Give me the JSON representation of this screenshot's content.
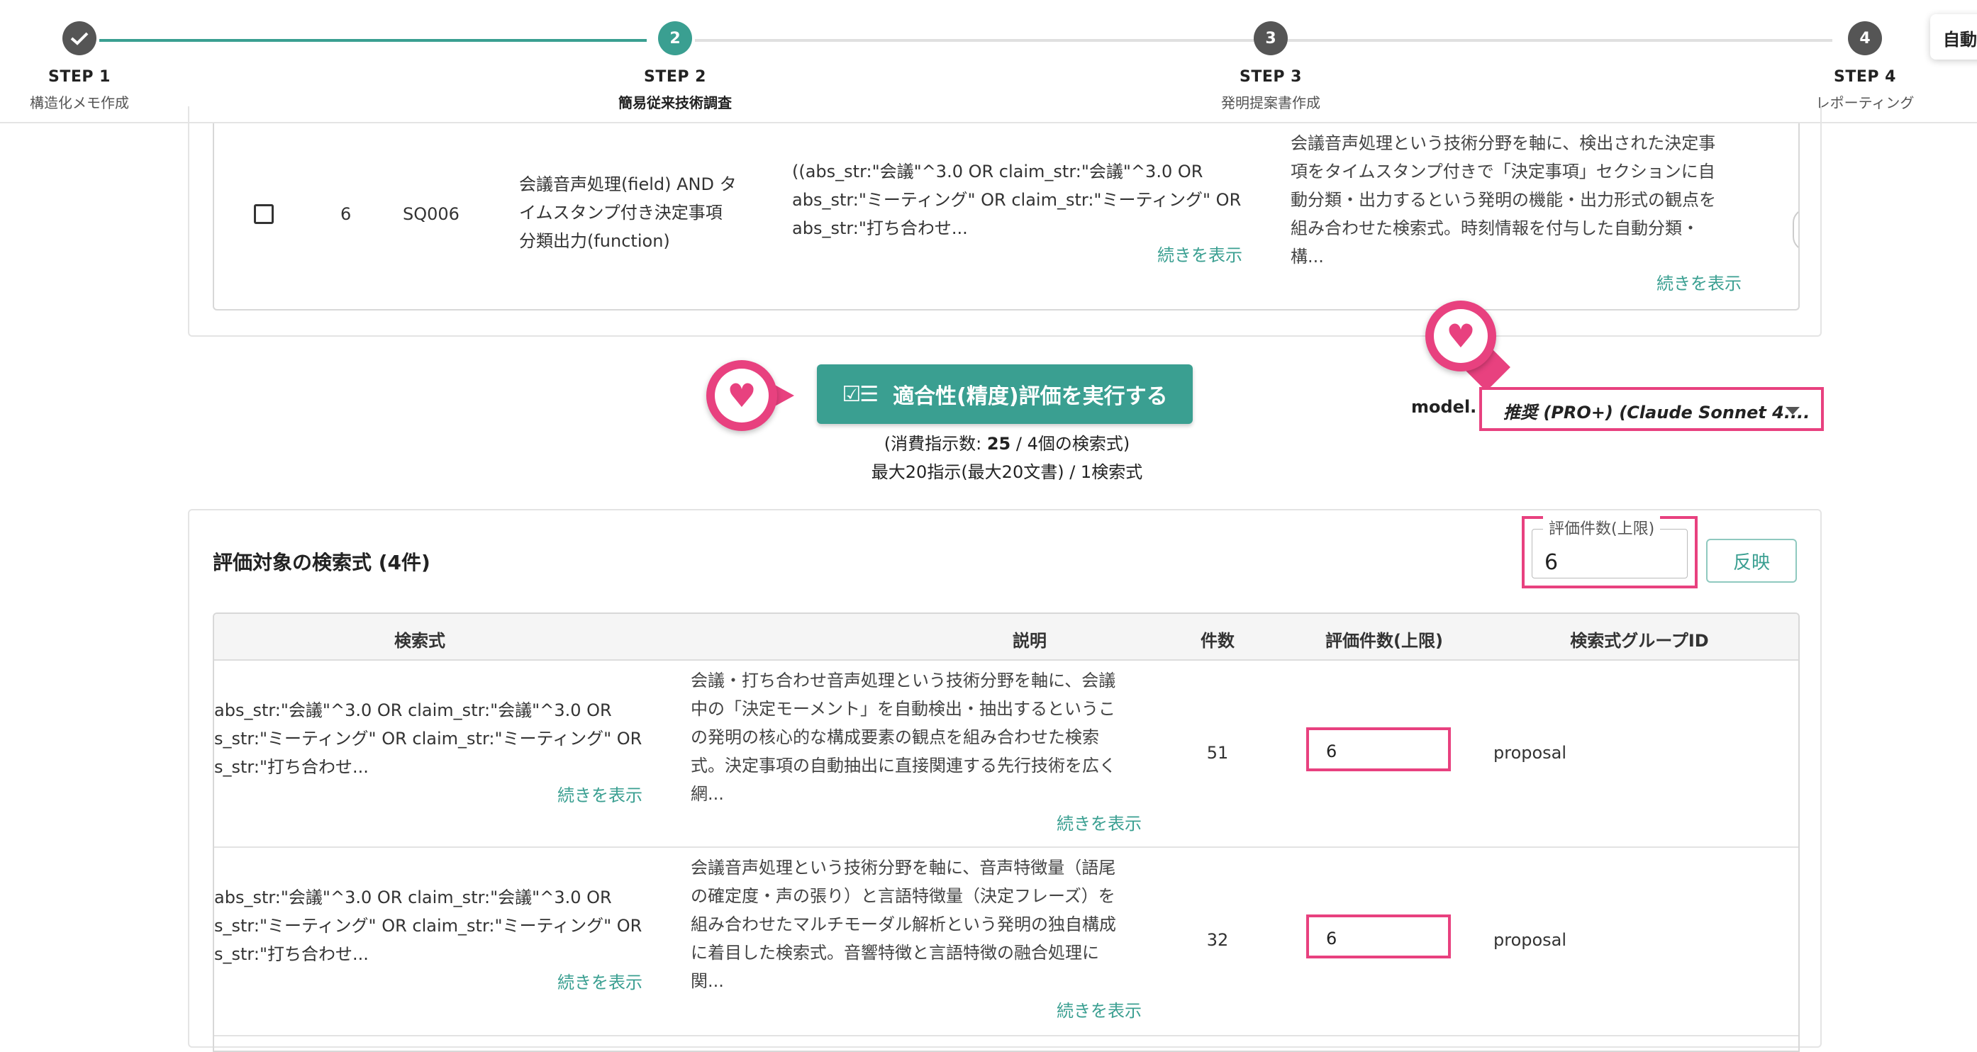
{
  "stepper": {
    "steps": [
      {
        "name": "STEP 1",
        "sub": "構造化メモ作成",
        "marker": "check-icon"
      },
      {
        "name": "STEP 2",
        "sub": "簡易従来技術調査",
        "marker": "2"
      },
      {
        "name": "STEP 3",
        "sub": "発明提案書作成",
        "marker": "3"
      },
      {
        "name": "STEP 4",
        "sub": "レポーティング",
        "marker": "4"
      }
    ],
    "auto_button": "自動"
  },
  "upper_row": {
    "no": "6",
    "id": "SQ006",
    "name": [
      "会議音声処理(field) AND タ",
      "イムスタンプ付き決定事項",
      "分類出力(function)"
    ],
    "query": [
      "((abs_str:\"会議\"^3.0 OR claim_str:\"会議\"^3.0 OR",
      "abs_str:\"ミーティング\" OR claim_str:\"ミーティング\" OR",
      "abs_str:\"打ち合わせ..."
    ],
    "query_more": "続きを表示",
    "desc": [
      "会議音声処理という技術分野を軸に、検出された決定事",
      "項をタイムスタンプ付きで「決定事項」セクションに自",
      "動分類・出力するという発明の機能・出力形式の観点を",
      "組み合わせた検索式。時刻情報を付与した自動分類・",
      "構..."
    ],
    "desc_more": "続きを表示"
  },
  "actions": {
    "run_button": "適合性(精度)評価を実行する",
    "consume_prefix": "(消費指示数: ",
    "consume_count": "25",
    "consume_suffix": " / 4個の検索式)",
    "max_note": "最大20指示(最大20文書) / 1検索式",
    "model_label": "model.",
    "model_value": "推奨 (PRO+) (Claude Sonnet 4...."
  },
  "eval_section": {
    "title": "評価対象の検索式 (4件)",
    "limit_legend": "評価件数(上限)",
    "limit_value": "6",
    "apply_button": "反映",
    "columns": [
      "検索式",
      "説明",
      "件数",
      "評価件数(上限)",
      "検索式グループID"
    ],
    "rows": [
      {
        "query": [
          "abs_str:\"会議\"^3.0 OR claim_str:\"会議\"^3.0 OR",
          "s_str:\"ミーティング\" OR claim_str:\"ミーティング\" OR",
          "s_str:\"打ち合わせ..."
        ],
        "query_more": "続きを表示",
        "desc": [
          "会議・打ち合わせ音声処理という技術分野を軸に、会議",
          "中の「決定モーメント」を自動検出・抽出するというこ",
          "の発明の核心的な構成要素の観点を組み合わせた検索",
          "式。決定事項の自動抽出に直接関連する先行技術を広く",
          "網..."
        ],
        "desc_more": "続きを表示",
        "count": "51",
        "limit": "6",
        "group": "proposal"
      },
      {
        "query": [
          "abs_str:\"会議\"^3.0 OR claim_str:\"会議\"^3.0 OR",
          "s_str:\"ミーティング\" OR claim_str:\"ミーティング\" OR",
          "s_str:\"打ち合わせ..."
        ],
        "query_more": "続きを表示",
        "desc": [
          "会議音声処理という技術分野を軸に、音声特徴量（語尾",
          "の確定度・声の張り）と言語特徴量（決定フレーズ）を",
          "組み合わせたマルチモーダル解析という発明の独自構成",
          "に着目した検索式。音響特徴と言語特徴の融合処理に",
          "関..."
        ],
        "desc_more": "続きを表示",
        "count": "32",
        "limit": "6",
        "group": "proposal"
      }
    ]
  },
  "colors": {
    "accent": "#3a9f91",
    "highlight": "#e8417f",
    "inactive_step": "#555555"
  }
}
